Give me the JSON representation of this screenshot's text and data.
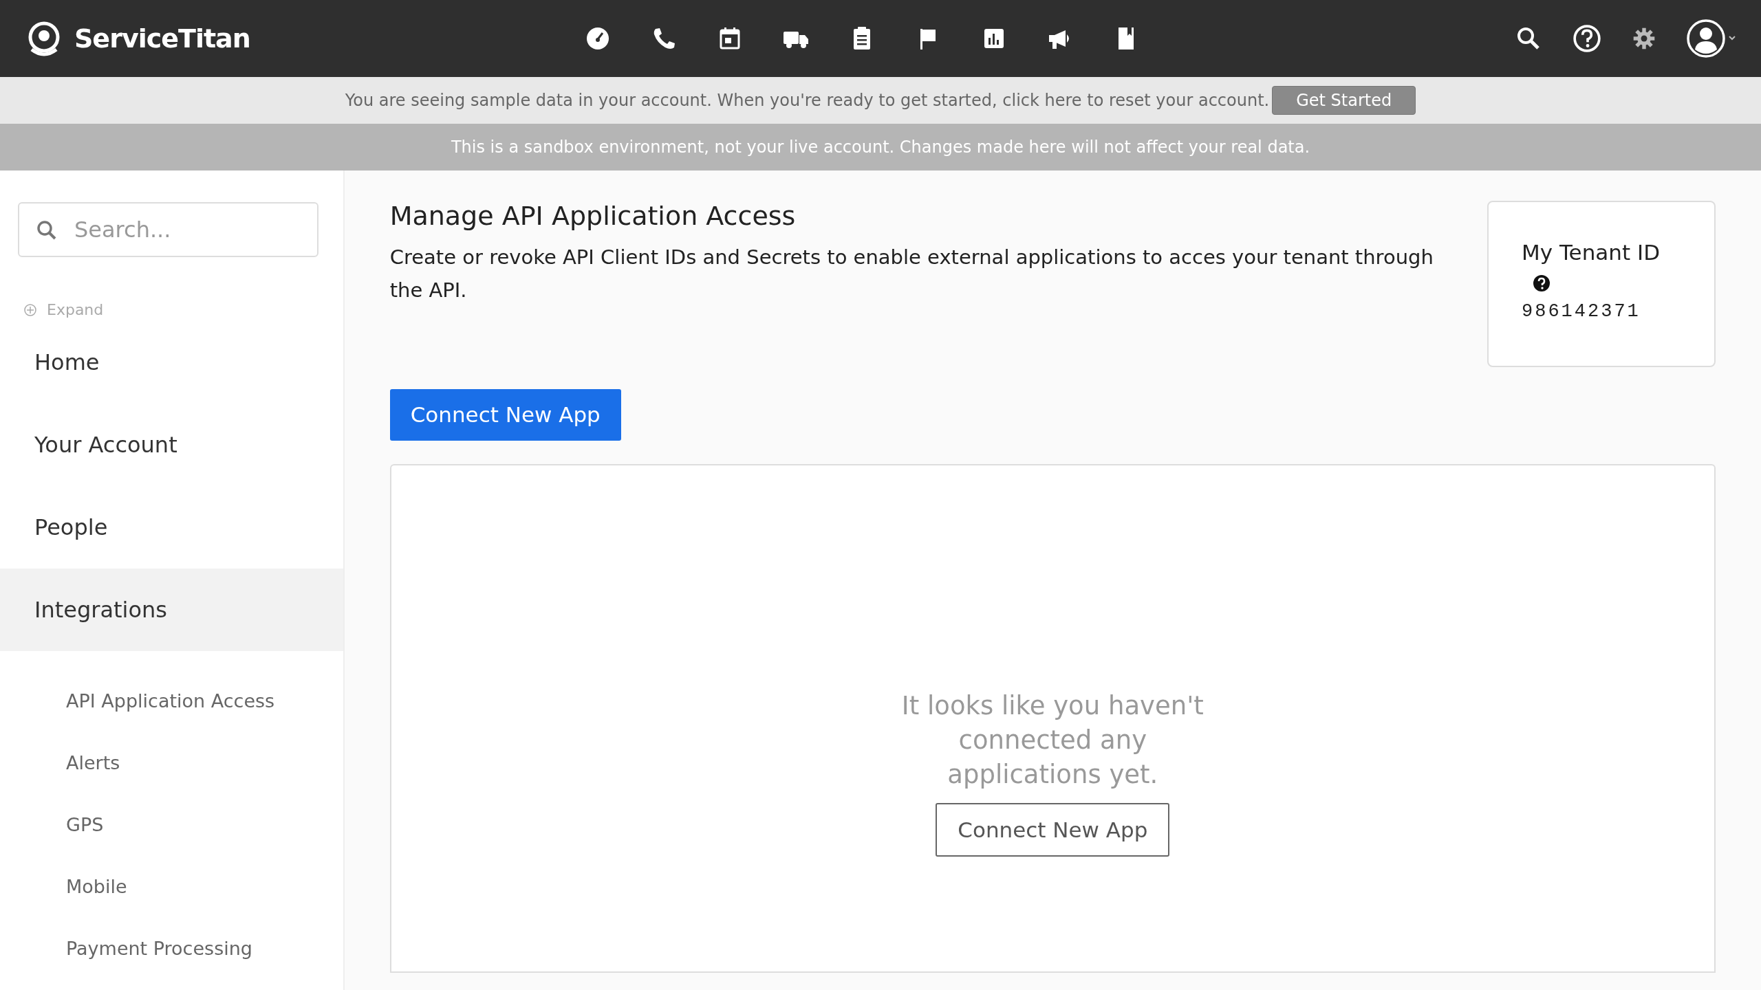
{
  "brand": "ServiceTitan",
  "sample_banner": {
    "text": "You are seeing sample data in your account. When you're ready to get started, click here to reset your account.",
    "button": "Get Started"
  },
  "sandbox_banner": "This is a sandbox environment, not your live account. Changes made here will not affect your real data.",
  "sidebar": {
    "search": {
      "placeholder": "Search..."
    },
    "expand": "Expand",
    "items": [
      {
        "label": "Home",
        "selected": false
      },
      {
        "label": "Your Account",
        "selected": false
      },
      {
        "label": "People",
        "selected": false
      },
      {
        "label": "Integrations",
        "selected": true
      }
    ],
    "sub_items": [
      {
        "label": "API Application Access"
      },
      {
        "label": "Alerts"
      },
      {
        "label": "GPS"
      },
      {
        "label": "Mobile"
      },
      {
        "label": "Payment Processing"
      }
    ]
  },
  "page": {
    "title": "Manage API Application Access",
    "description": "Create or revoke API Client IDs and Secrets to enable external applications to acces your tenant through the API.",
    "primary_button": "Connect New App",
    "tenant": {
      "label": "My Tenant ID",
      "value": "986142371"
    },
    "empty": {
      "message": "It looks like you haven't connected any applications yet.",
      "button": "Connect New App"
    }
  }
}
